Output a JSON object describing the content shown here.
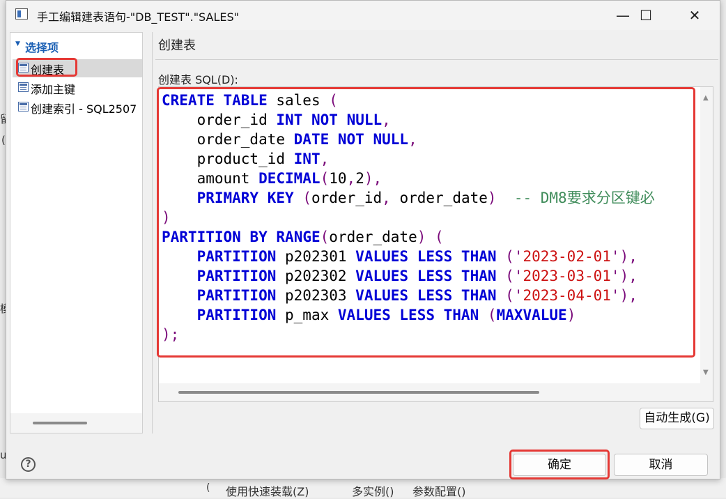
{
  "window": {
    "title": "手工编辑建表语句-\"DB_TEST\".\"SALES\"",
    "minimize_glyph": "—",
    "maximize_glyph": "☐",
    "close_glyph": "✕"
  },
  "background": {
    "fragments": [
      "留",
      "(",
      "模",
      "u",
      "(",
      "使用快速装载(Z)",
      "多实例()",
      "参数配置()"
    ]
  },
  "sidebar": {
    "header": "选择项",
    "items": [
      {
        "label": "创建表",
        "selected": true,
        "icon": "table-icon"
      },
      {
        "label": "添加主键",
        "selected": false,
        "icon": "table-icon"
      },
      {
        "label": "创建索引 - SQL2507",
        "selected": false,
        "icon": "table-icon"
      }
    ]
  },
  "main": {
    "page_title": "创建表",
    "sql_label": "创建表 SQL(D):",
    "sql_lines": [
      "CREATE TABLE sales (",
      "    order_id INT NOT NULL,",
      "    order_date DATE NOT NULL,",
      "    product_id INT,",
      "    amount DECIMAL(10,2),",
      "    PRIMARY KEY (order_id, order_date)  -- DM8要求分区键必",
      ")",
      "PARTITION BY RANGE(order_date) (",
      "    PARTITION p202301 VALUES LESS THAN ('2023-02-01'),",
      "    PARTITION p202302 VALUES LESS THAN ('2023-03-01'),",
      "    PARTITION p202303 VALUES LESS THAN ('2023-04-01'),",
      "    PARTITION p_max VALUES LESS THAN (MAXVALUE)",
      ");"
    ],
    "auto_generate_label": "自动生成(G)"
  },
  "footer": {
    "help_glyph": "?",
    "ok_label": "确定",
    "cancel_label": "取消"
  },
  "colors": {
    "keyword": "#0000d6",
    "string": "#cc1111",
    "comment": "#3f8c5a",
    "punctuation": "#7a0a7a",
    "highlight": "#e53935"
  }
}
